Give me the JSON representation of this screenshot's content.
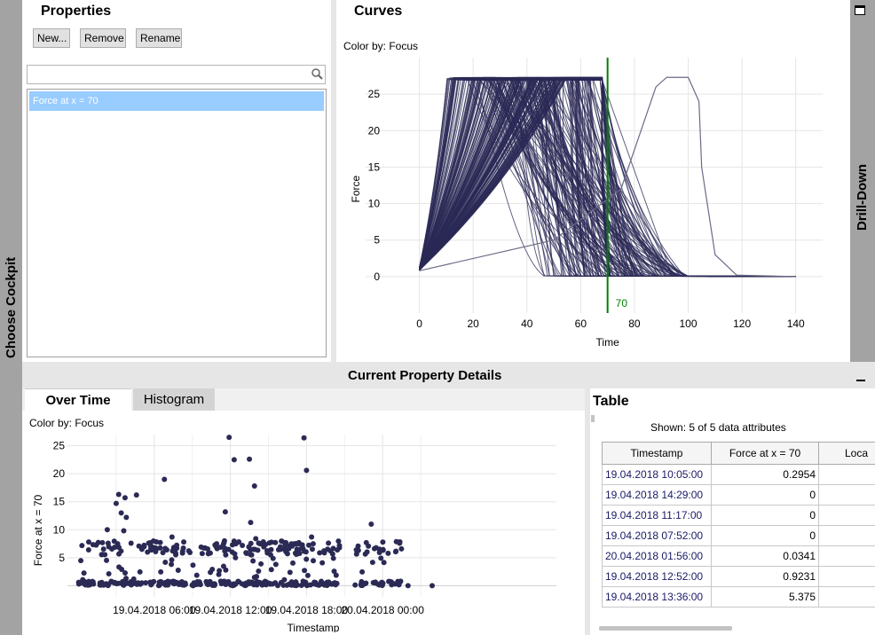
{
  "sidebar_left": {
    "label": "Choose Cockpit"
  },
  "sidebar_right": {
    "label": "Drill-Down"
  },
  "properties": {
    "title": "Properties",
    "buttons": {
      "new": "New...",
      "remove": "Remove",
      "rename": "Rename"
    },
    "search_value": "",
    "items": [
      "Force at x = 70"
    ]
  },
  "curves": {
    "title": "Curves",
    "color_by": "Color by: Focus",
    "marker_label": "70"
  },
  "details": {
    "title": "Current Property Details"
  },
  "tabs": {
    "over_time": "Over Time",
    "histogram": "Histogram"
  },
  "over_time": {
    "color_by": "Color by: Focus"
  },
  "table": {
    "title": "Table",
    "shown": "Shown: 5 of 5 data attributes",
    "columns": [
      "Timestamp",
      "Force at x = 70",
      "Loca"
    ],
    "rows": [
      [
        "19.04.2018 10:05:00",
        "0.2954"
      ],
      [
        "19.04.2018 14:29:00",
        "0"
      ],
      [
        "19.04.2018 11:17:00",
        "0"
      ],
      [
        "19.04.2018 07:52:00",
        "0"
      ],
      [
        "20.04.2018 01:56:00",
        "0.0341"
      ],
      [
        "19.04.2018 12:52:00",
        "0.9231"
      ],
      [
        "19.04.2018 13:36:00",
        "5.375"
      ]
    ]
  },
  "chart_data": [
    {
      "type": "line",
      "xlabel": "Time",
      "ylabel": "Force",
      "xlim": [
        -20,
        150
      ],
      "ylim": [
        -5,
        30
      ],
      "xticks": [
        0,
        20,
        40,
        60,
        80,
        100,
        120,
        140
      ],
      "yticks": [
        0,
        5,
        10,
        15,
        20,
        25
      ],
      "grid": true,
      "series_color": "#2b2a55",
      "marker": {
        "x": 70,
        "color": "#008000"
      },
      "curve_family": {
        "count": 180,
        "rise_start": 0,
        "plateau": 27.3,
        "rise_end_range": [
          10,
          55
        ],
        "fall_end_range": [
          45,
          100
        ],
        "end_x": 140
      },
      "outlier_curve": [
        [
          0,
          0.8
        ],
        [
          50,
          5
        ],
        [
          75,
          12
        ],
        [
          88,
          26
        ],
        [
          92,
          27.3
        ],
        [
          100,
          27.3
        ],
        [
          104,
          24
        ],
        [
          105,
          15
        ],
        [
          110,
          3
        ],
        [
          118,
          0.2
        ],
        [
          140,
          0
        ]
      ]
    },
    {
      "type": "scatter",
      "xlabel": "Timestamp",
      "ylabel": "Force at x = 70",
      "x_ticks": [
        "19.04.2018 06:00",
        "19.04.2018 12:00",
        "19.04.2018 18:00",
        "20.04.2018 00:00"
      ],
      "yticks": [
        5,
        10,
        15,
        20,
        25
      ],
      "ylim": [
        -2,
        27
      ],
      "grid": true,
      "point_color": "#2b2a55",
      "highlight_points_hours": [
        [
          6.8,
          19
        ],
        [
          11.9,
          26.5
        ],
        [
          12.3,
          22.5
        ],
        [
          13.5,
          22.6
        ],
        [
          13.9,
          17.8
        ],
        [
          17.8,
          26.4
        ],
        [
          18.0,
          20.6
        ],
        [
          11.6,
          13.2
        ],
        [
          4.6,
          16.2
        ],
        [
          3.2,
          16.3
        ],
        [
          3.7,
          15.7
        ],
        [
          3.0,
          14.7
        ],
        [
          3.4,
          13.0
        ],
        [
          3.8,
          12.2
        ],
        [
          23.1,
          11.0
        ],
        [
          13.6,
          11.3
        ],
        [
          2.3,
          10.0
        ],
        [
          3.6,
          9.8
        ],
        [
          7.4,
          8.7
        ],
        [
          14.0,
          8.4
        ],
        [
          18.4,
          8.7
        ],
        [
          26.0,
          0
        ],
        [
          27.9,
          0
        ]
      ],
      "dense_band_hours": [
        0,
        25.5
      ],
      "gaps_hours": [
        [
          20.6,
          21.8
        ],
        [
          24.1,
          24.4
        ]
      ]
    }
  ]
}
